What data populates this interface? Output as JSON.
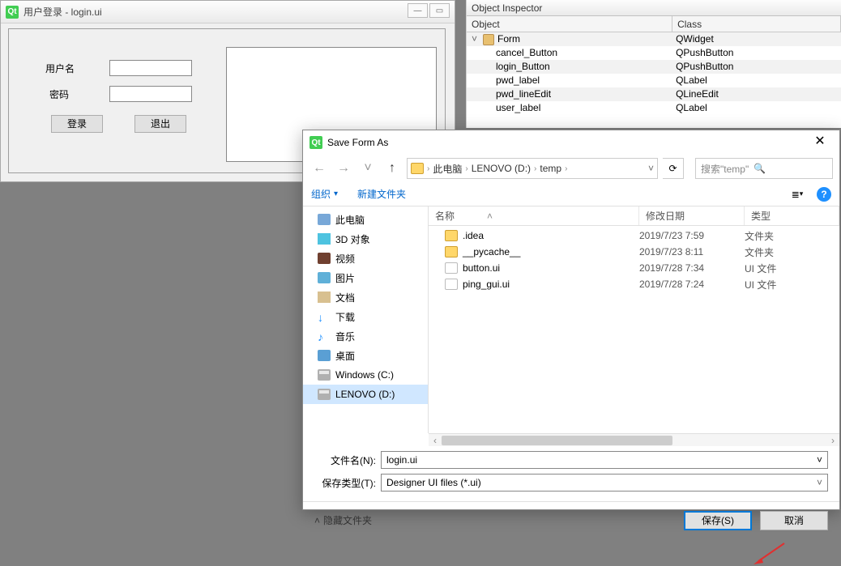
{
  "login_window": {
    "title": "用户登录 - login.ui",
    "user_label": "用户名",
    "pwd_label": "密码",
    "login_btn": "登录",
    "exit_btn": "退出"
  },
  "inspector": {
    "title": "Object Inspector",
    "col_object": "Object",
    "col_class": "Class",
    "rows": [
      {
        "name": "Form",
        "cls": "QWidget",
        "indent": 0,
        "arrow": "˅",
        "icon": true
      },
      {
        "name": "cancel_Button",
        "cls": "QPushButton",
        "indent": 1
      },
      {
        "name": "login_Button",
        "cls": "QPushButton",
        "indent": 1
      },
      {
        "name": "pwd_label",
        "cls": "QLabel",
        "indent": 1
      },
      {
        "name": "pwd_lineEdit",
        "cls": "QLineEdit",
        "indent": 1
      },
      {
        "name": "user_label",
        "cls": "QLabel",
        "indent": 1
      }
    ]
  },
  "save_dialog": {
    "title": "Save Form As",
    "breadcrumbs": [
      "此电脑",
      "LENOVO (D:)",
      "temp"
    ],
    "search_placeholder": "搜索\"temp\"",
    "organize": "组织",
    "new_folder": "新建文件夹",
    "tree": [
      {
        "label": "此电脑",
        "icon": "ico-pc"
      },
      {
        "label": "3D 对象",
        "icon": "ico-3d"
      },
      {
        "label": "视频",
        "icon": "ico-vid"
      },
      {
        "label": "图片",
        "icon": "ico-pic"
      },
      {
        "label": "文档",
        "icon": "ico-doc"
      },
      {
        "label": "下载",
        "icon": "ico-dl",
        "glyph": "↓"
      },
      {
        "label": "音乐",
        "icon": "ico-mus",
        "glyph": "♪"
      },
      {
        "label": "桌面",
        "icon": "ico-dsk"
      },
      {
        "label": "Windows (C:)",
        "icon": "ico-drv"
      },
      {
        "label": "LENOVO (D:)",
        "icon": "ico-drv",
        "sel": true
      }
    ],
    "cols": {
      "name": "名称",
      "date": "修改日期",
      "type": "类型"
    },
    "files": [
      {
        "name": ".idea",
        "date": "2019/7/23 7:59",
        "type": "文件夹",
        "folder": true
      },
      {
        "name": "__pycache__",
        "date": "2019/7/23 8:11",
        "type": "文件夹",
        "folder": true
      },
      {
        "name": "button.ui",
        "date": "2019/7/28 7:34",
        "type": "UI 文件",
        "folder": false
      },
      {
        "name": "ping_gui.ui",
        "date": "2019/7/28 7:24",
        "type": "UI 文件",
        "folder": false
      }
    ],
    "filename_label": "文件名(N):",
    "filename_value": "login.ui",
    "filetype_label": "保存类型(T):",
    "filetype_value": "Designer UI files (*.ui)",
    "hide_folders": "隐藏文件夹",
    "save_btn": "保存(S)",
    "cancel_btn": "取消"
  }
}
